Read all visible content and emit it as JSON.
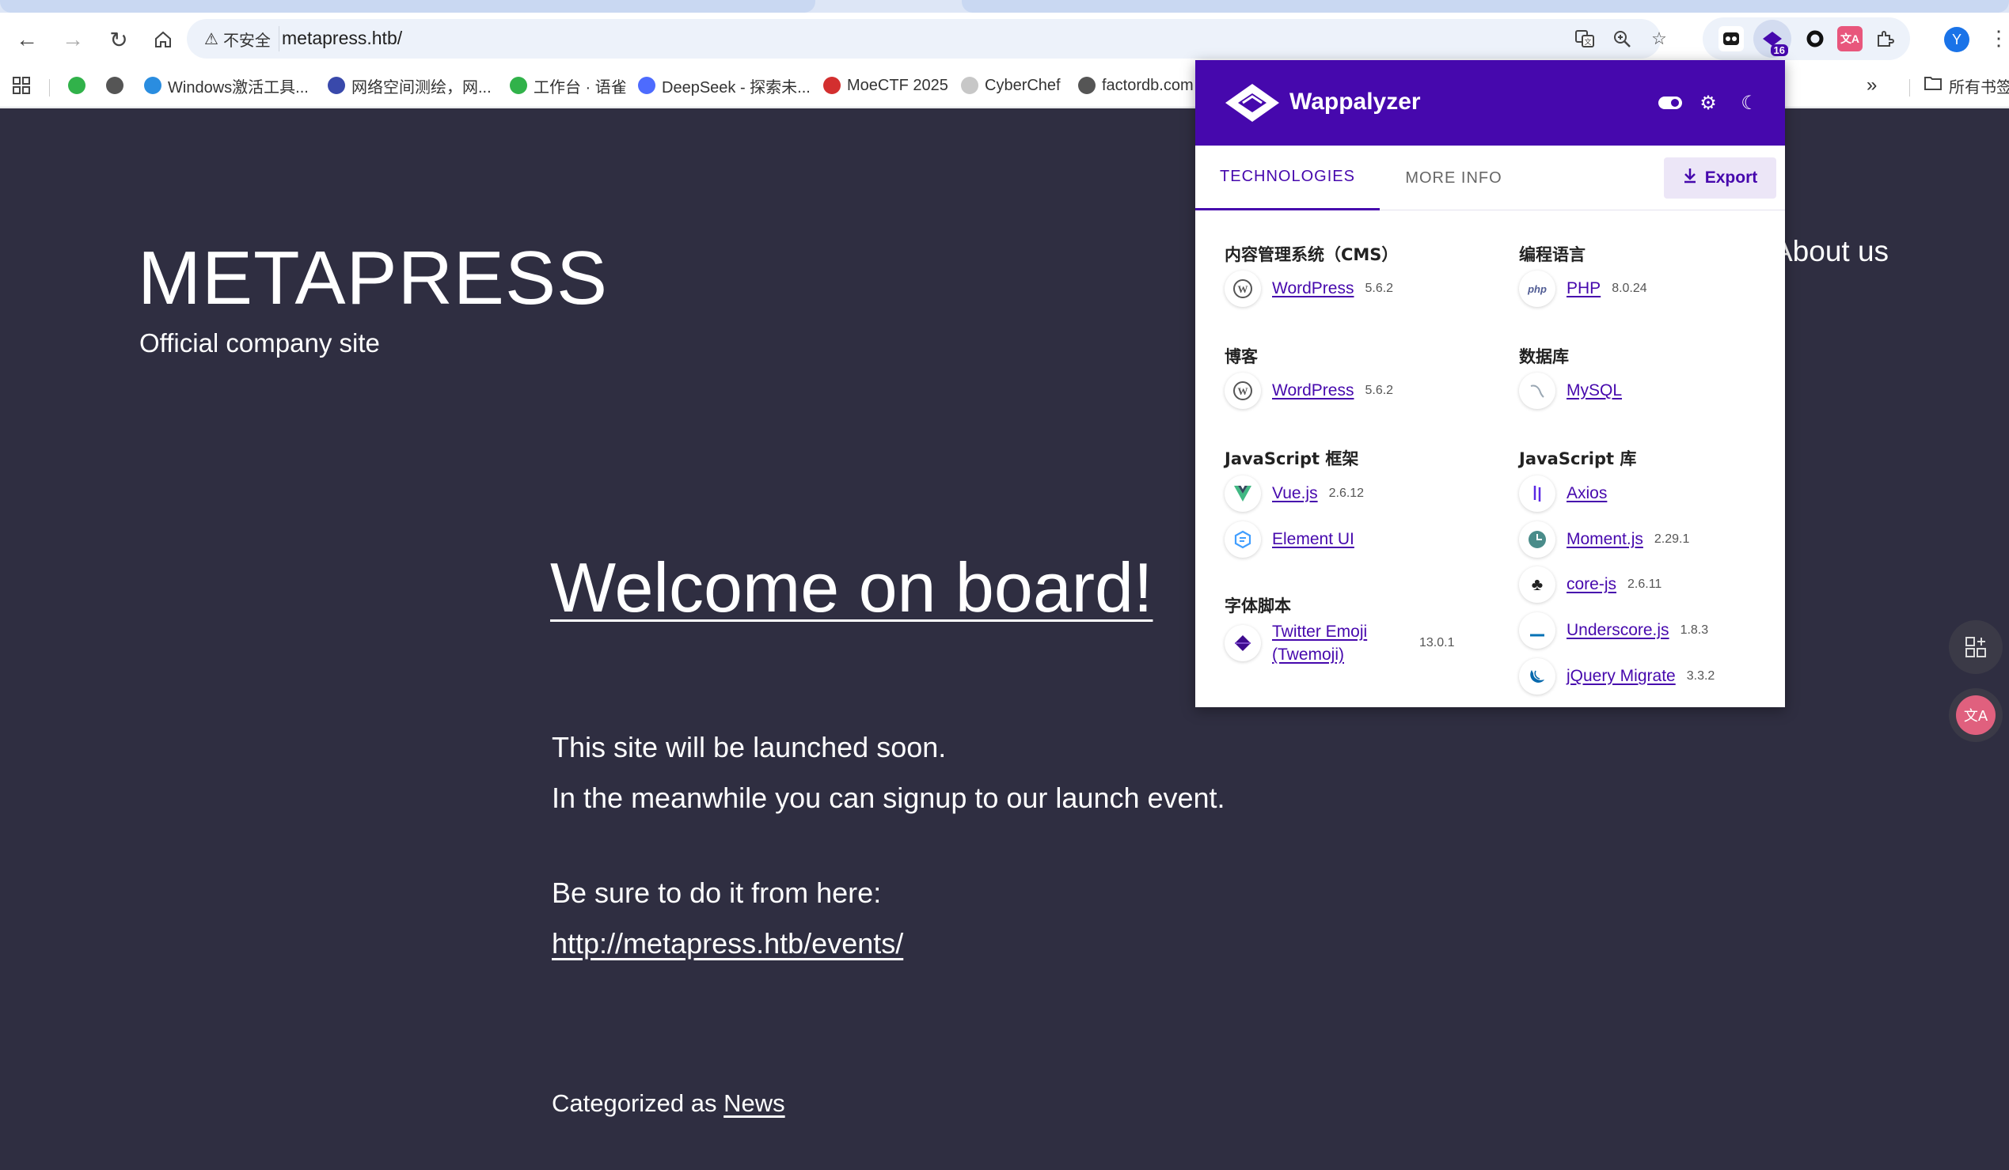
{
  "browser": {
    "security_label": "不安全",
    "url": "metapress.htb/",
    "extension_badge": "16",
    "profile_initial": "Y",
    "bookmarks": [
      {
        "label": "Windows激活工具..."
      },
      {
        "label": "网络空间测绘，网..."
      },
      {
        "label": "工作台 · 语雀"
      },
      {
        "label": "DeepSeek - 探索未..."
      },
      {
        "label": "MoeCTF 2025"
      },
      {
        "label": "CyberChef"
      },
      {
        "label": "factordb.com"
      }
    ],
    "bookmarks_overflow": "»",
    "all_bookmarks": "所有书签"
  },
  "page": {
    "site_title": "METAPRESS",
    "site_description": "Official company site",
    "nav_about": "About us",
    "heading": "Welcome on board!",
    "line1": "This site will be launched soon.",
    "line2": "In the meanwhile you can signup to our launch event.",
    "line3": "Be sure to do it from here:",
    "events_link": "http://metapress.htb/events/",
    "categorized_prefix": "Categorized as",
    "category": "News"
  },
  "wappalyzer": {
    "brand": "Wappalyzer",
    "tab_technologies": "TECHNOLOGIES",
    "tab_more_info": "MORE INFO",
    "export_label": "Export",
    "left_column": [
      {
        "category": "内容管理系统（CMS）",
        "items": [
          {
            "name": "WordPress",
            "version": "5.6.2",
            "icon": "wordpress-icon"
          }
        ]
      },
      {
        "category": "博客",
        "items": [
          {
            "name": "WordPress",
            "version": "5.6.2",
            "icon": "wordpress-icon"
          }
        ]
      },
      {
        "category": "JavaScript 框架",
        "items": [
          {
            "name": "Vue.js",
            "version": "2.6.12",
            "icon": "vue-icon"
          },
          {
            "name": "Element UI",
            "version": "",
            "icon": "element-ui-icon"
          }
        ]
      },
      {
        "category": "字体脚本",
        "items": [
          {
            "name": "Twitter Emoji (Twemoji)",
            "version": "13.0.1",
            "icon": "twemoji-icon"
          }
        ]
      }
    ],
    "right_column": [
      {
        "category": "编程语言",
        "items": [
          {
            "name": "PHP",
            "version": "8.0.24",
            "icon": "php-icon"
          }
        ]
      },
      {
        "category": "数据库",
        "items": [
          {
            "name": "MySQL",
            "version": "",
            "icon": "mysql-icon"
          }
        ]
      },
      {
        "category": "JavaScript 库",
        "items": [
          {
            "name": "Axios",
            "version": "",
            "icon": "axios-icon"
          },
          {
            "name": "Moment.js",
            "version": "2.29.1",
            "icon": "moment-icon"
          },
          {
            "name": "core-js",
            "version": "2.6.11",
            "icon": "core-js-icon"
          },
          {
            "name": "Underscore.js",
            "version": "1.8.3",
            "icon": "underscore-icon"
          },
          {
            "name": "jQuery Migrate",
            "version": "3.3.2",
            "icon": "jquery-icon"
          }
        ]
      }
    ]
  },
  "colors": {
    "wappalyzer_purple": "#4608ad",
    "page_background": "#2f2e41"
  }
}
